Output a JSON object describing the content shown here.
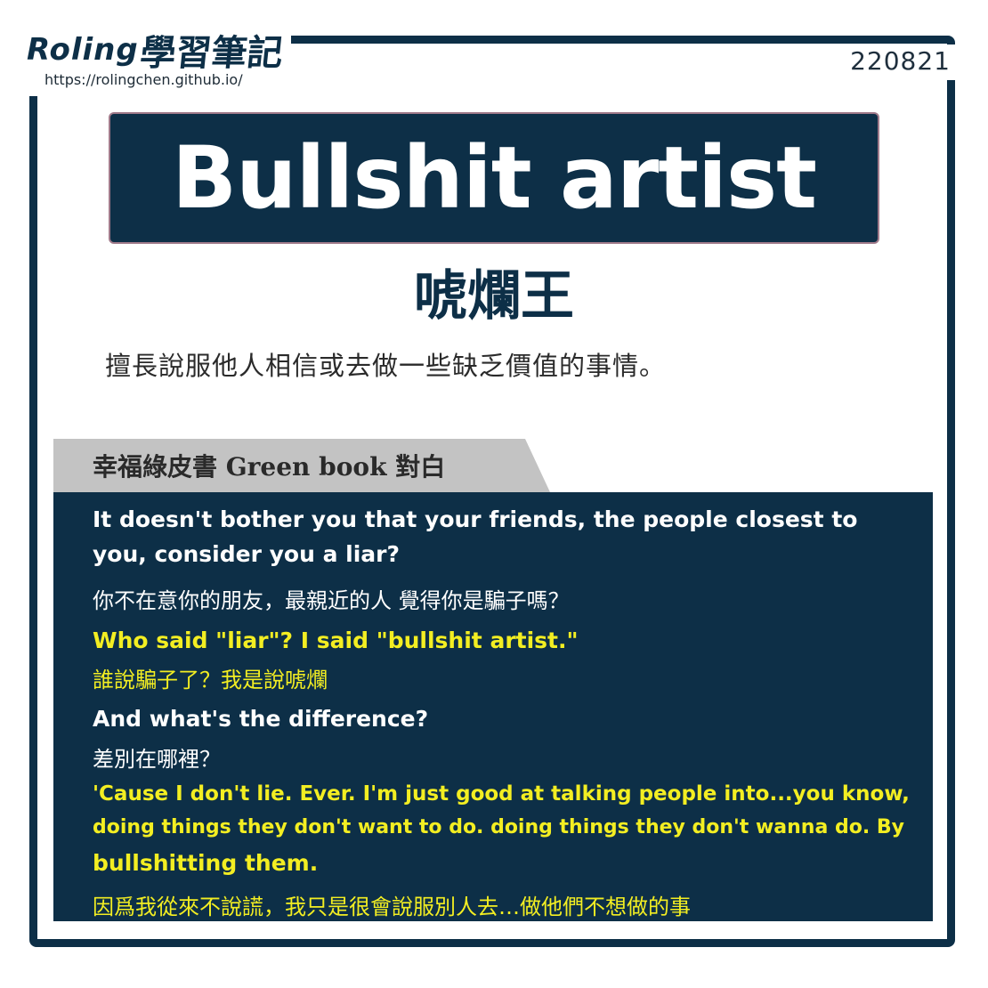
{
  "brand": {
    "logo_text_latin": "Roling",
    "logo_text_cjk": "學習筆記",
    "url": "https://rolingchen.github.io/",
    "date": "220821"
  },
  "card": {
    "title": "Bullshit artist",
    "subtitle": "唬爛王",
    "definition": "擅長說服他人相信或去做一些缺乏價值的事情。"
  },
  "dialogue": {
    "heading": "幸福綠皮書 Green book 對白",
    "lines": [
      {
        "en": "It doesn't bother you that your friends, the people closest to",
        "en2": "you, consider you a liar?",
        "zh": "你不在意你的朋友，最親近的人 覺得你是騙子嗎？"
      },
      {
        "en": "Who said  \"liar\"?  I said  \"bullshit artist.\"",
        "zh": "誰說騙子了？我是說唬爛"
      },
      {
        "en": "And what's the difference?",
        "zh": "差別在哪裡？"
      },
      {
        "en": "'Cause I don't lie. Ever.  I'm just good at talking people into...you know,",
        "en2": "doing things they don't want to do. doing things they don't wanna do. By",
        "en3": "bullshitting them.",
        "zh": "因爲我從來不說謊，我只是很會說服別人去…做他們不想做的事"
      }
    ]
  },
  "colors": {
    "navy": "#0d2f47",
    "highlight": "#f3ee22",
    "tab_gray": "#c3c3c3"
  }
}
